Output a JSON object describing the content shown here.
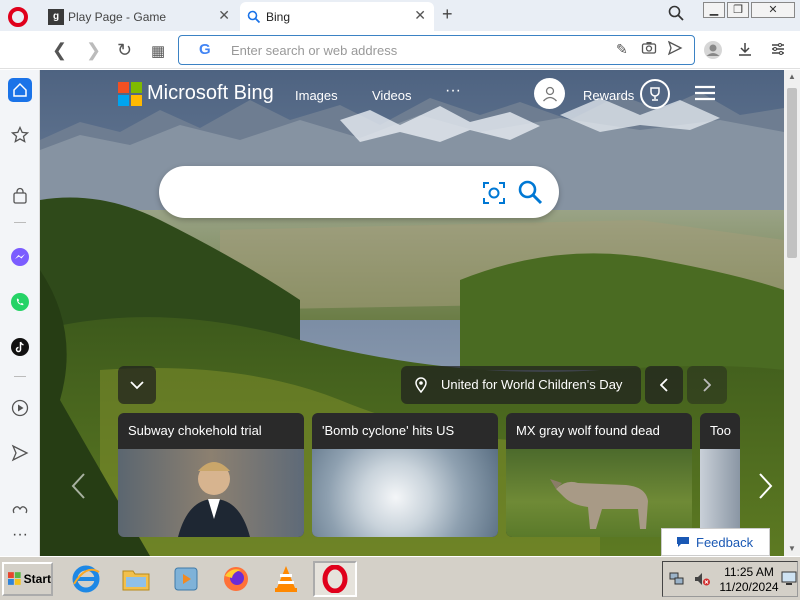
{
  "tabs": [
    {
      "title": "Play Page - Game",
      "favicon": "gamepage-icon"
    },
    {
      "title": "Bing",
      "favicon": "bing-icon"
    }
  ],
  "address": {
    "placeholder": "Enter search or web address",
    "value": ""
  },
  "bing": {
    "brand": "Microsoft Bing",
    "nav": [
      "Images",
      "Videos",
      "···"
    ],
    "rewards": "Rewards",
    "caption": "United for World Children's Day"
  },
  "news": [
    {
      "title": "Subway chokehold trial"
    },
    {
      "title": "'Bomb cyclone' hits US"
    },
    {
      "title": "MX gray wolf found dead"
    },
    {
      "title": "Too"
    }
  ],
  "feedback": "Feedback",
  "taskbar": {
    "start": "Start",
    "time": "11:25 AM",
    "date": "11/20/2024"
  },
  "colors": {
    "accent": "#3b82c4",
    "opera_red": "#e0001b",
    "bing_blue": "#0078d4"
  }
}
